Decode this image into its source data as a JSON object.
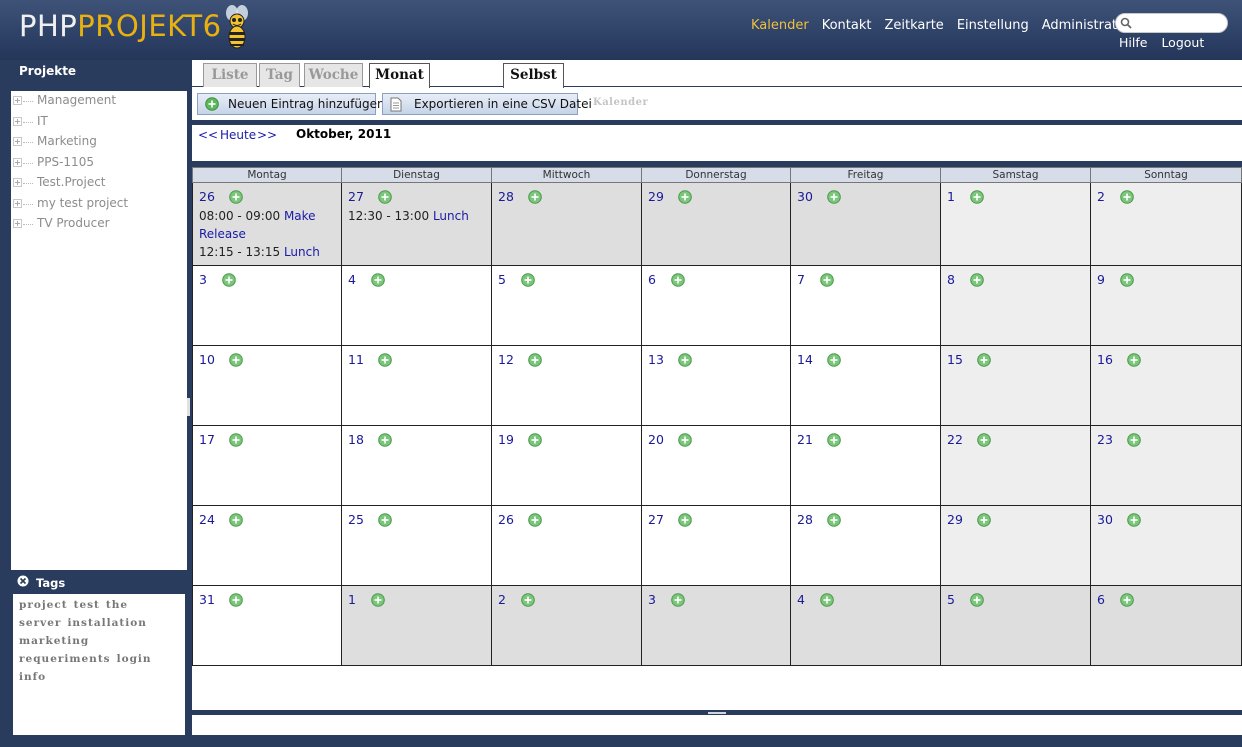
{
  "app": {
    "logo_php": "PHP",
    "logo_projekt": "ROJEKT6",
    "logo_p": "P"
  },
  "topnav": [
    "Kalender",
    "Kontakt",
    "Zeitkarte",
    "Einstellung",
    "Administration"
  ],
  "topnav_active": "Kalender",
  "search": {
    "value": "",
    "placeholder": ""
  },
  "usernav": [
    "Hilfe",
    "Logout"
  ],
  "sidebar": {
    "title": "Projekte",
    "projects": [
      "Management",
      "IT",
      "Marketing",
      "PPS-1105",
      "Test.Project",
      "my test project",
      "TV Producer"
    ]
  },
  "tags": {
    "title": "Tags",
    "items": [
      "project",
      "test",
      "the",
      "server",
      "installation",
      "marketing",
      "requeriments",
      "login",
      "info"
    ]
  },
  "tabs": {
    "liste": "Liste",
    "tag": "Tag",
    "woche": "Woche",
    "monat": "Monat",
    "selbst": "Selbst",
    "active": "Monat"
  },
  "toolbar": {
    "add_label": "Neuen Eintrag hinzufügen",
    "export_label": "Exportieren in eine CSV Datei",
    "section_label": "Kalender"
  },
  "nav": {
    "prev": "<<",
    "today": "Heute",
    "next": ">>",
    "month": "Oktober, 2011"
  },
  "calendar": {
    "weekdays": [
      "Montag",
      "Dienstag",
      "Mittwoch",
      "Donnerstag",
      "Freitag",
      "Samstag",
      "Sonntag"
    ],
    "weeks": [
      [
        {
          "day": "26",
          "shade": "grey",
          "events": [
            {
              "time": "08:00 - 09:00",
              "title": "Make"
            },
            {
              "time": "",
              "title": "Release"
            },
            {
              "time": "12:15 - 13:15",
              "title": "Lunch"
            }
          ]
        },
        {
          "day": "27",
          "shade": "grey",
          "events": [
            {
              "time": "12:30 - 13:00",
              "title": "Lunch"
            }
          ]
        },
        {
          "day": "28",
          "shade": "grey",
          "events": []
        },
        {
          "day": "29",
          "shade": "grey",
          "events": []
        },
        {
          "day": "30",
          "shade": "grey",
          "events": []
        },
        {
          "day": "1",
          "shade": "light",
          "events": []
        },
        {
          "day": "2",
          "shade": "light",
          "events": []
        }
      ],
      [
        {
          "day": "3",
          "shade": "white",
          "events": []
        },
        {
          "day": "4",
          "shade": "white",
          "events": []
        },
        {
          "day": "5",
          "shade": "white",
          "events": []
        },
        {
          "day": "6",
          "shade": "white",
          "events": []
        },
        {
          "day": "7",
          "shade": "white",
          "events": []
        },
        {
          "day": "8",
          "shade": "light",
          "events": []
        },
        {
          "day": "9",
          "shade": "light",
          "events": []
        }
      ],
      [
        {
          "day": "10",
          "shade": "white",
          "events": []
        },
        {
          "day": "11",
          "shade": "white",
          "events": []
        },
        {
          "day": "12",
          "shade": "white",
          "events": []
        },
        {
          "day": "13",
          "shade": "white",
          "events": []
        },
        {
          "day": "14",
          "shade": "white",
          "events": []
        },
        {
          "day": "15",
          "shade": "light",
          "events": []
        },
        {
          "day": "16",
          "shade": "light",
          "events": []
        }
      ],
      [
        {
          "day": "17",
          "shade": "white",
          "events": []
        },
        {
          "day": "18",
          "shade": "white",
          "events": []
        },
        {
          "day": "19",
          "shade": "white",
          "events": []
        },
        {
          "day": "20",
          "shade": "white",
          "events": []
        },
        {
          "day": "21",
          "shade": "white",
          "events": []
        },
        {
          "day": "22",
          "shade": "light",
          "events": []
        },
        {
          "day": "23",
          "shade": "light",
          "events": []
        }
      ],
      [
        {
          "day": "24",
          "shade": "white",
          "events": []
        },
        {
          "day": "25",
          "shade": "white",
          "events": []
        },
        {
          "day": "26",
          "shade": "white",
          "events": []
        },
        {
          "day": "27",
          "shade": "white",
          "events": []
        },
        {
          "day": "28",
          "shade": "white",
          "events": []
        },
        {
          "day": "29",
          "shade": "light",
          "events": []
        },
        {
          "day": "30",
          "shade": "light",
          "events": []
        }
      ],
      [
        {
          "day": "31",
          "shade": "white",
          "events": []
        },
        {
          "day": "1",
          "shade": "grey",
          "events": []
        },
        {
          "day": "2",
          "shade": "grey",
          "events": []
        },
        {
          "day": "3",
          "shade": "grey",
          "events": []
        },
        {
          "day": "4",
          "shade": "grey",
          "events": []
        },
        {
          "day": "5",
          "shade": "grey",
          "events": []
        },
        {
          "day": "6",
          "shade": "grey",
          "events": []
        }
      ]
    ]
  },
  "colors": {
    "frame": "#2a3c5e",
    "accent": "#e8b10f",
    "link": "#1a1aa8",
    "add_icon": "#4caf50"
  },
  "icons": [
    "bee-logo-icon",
    "search-icon",
    "tree-expand-icon",
    "tags-close-icon",
    "add-entry-icon",
    "csv-export-icon",
    "add-day-entry-icon"
  ]
}
